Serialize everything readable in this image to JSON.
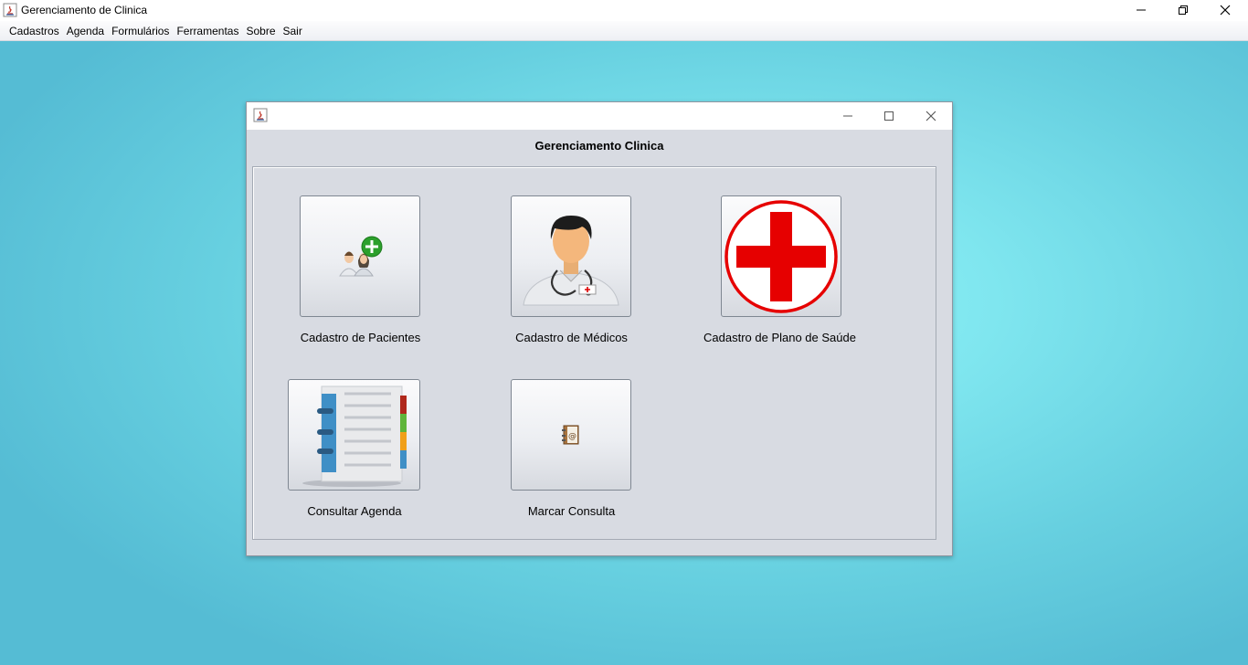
{
  "window": {
    "title": "Gerenciamento de Clinica"
  },
  "menu": [
    "Cadastros",
    "Agenda",
    "Formulários",
    "Ferramentas",
    "Sobre",
    "Sair"
  ],
  "frame": {
    "heading": "Gerenciamento Clinica",
    "buttons": {
      "pacientes": {
        "label": "Cadastro de Pacientes",
        "icon": "add-patients-icon"
      },
      "medicos": {
        "label": "Cadastro de Médicos",
        "icon": "doctor-icon"
      },
      "plano": {
        "label": "Cadastro de Plano de Saúde",
        "icon": "red-cross-icon"
      },
      "agenda": {
        "label": "Consultar Agenda",
        "icon": "agenda-book-icon"
      },
      "consulta": {
        "label": "Marcar Consulta",
        "icon": "address-book-icon"
      }
    }
  },
  "colors": {
    "desktop": "#7fe6ef",
    "cross": "#e60000",
    "frame_bg": "#d8dbe2"
  }
}
